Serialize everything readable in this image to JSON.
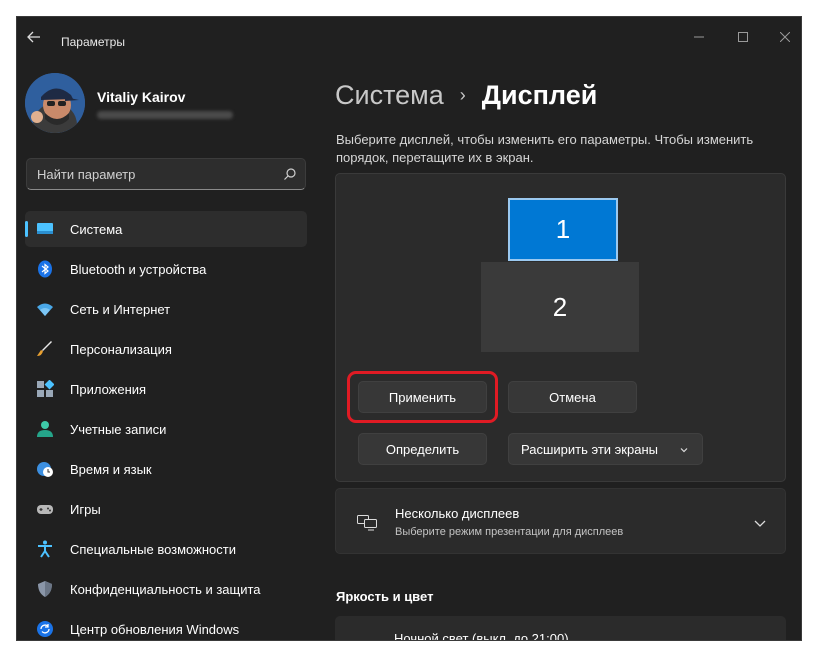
{
  "window": {
    "title": "Параметры"
  },
  "profile": {
    "name": "Vitaliy Kairov"
  },
  "search": {
    "placeholder": "Найти параметр"
  },
  "sidebar": {
    "items": [
      {
        "label": "Система",
        "icon": "display-icon",
        "active": true
      },
      {
        "label": "Bluetooth и устройства",
        "icon": "bluetooth-icon"
      },
      {
        "label": "Сеть и Интернет",
        "icon": "wifi-icon"
      },
      {
        "label": "Персонализация",
        "icon": "brush-icon"
      },
      {
        "label": "Приложения",
        "icon": "apps-icon"
      },
      {
        "label": "Учетные записи",
        "icon": "account-icon"
      },
      {
        "label": "Время и язык",
        "icon": "globe-clock-icon"
      },
      {
        "label": "Игры",
        "icon": "gamepad-icon"
      },
      {
        "label": "Специальные возможности",
        "icon": "accessibility-icon"
      },
      {
        "label": "Конфиденциальность и защита",
        "icon": "shield-icon"
      },
      {
        "label": "Центр обновления Windows",
        "icon": "update-icon"
      }
    ]
  },
  "breadcrumb": {
    "parent": "Система",
    "separator": "›",
    "current": "Дисплей"
  },
  "main": {
    "description": "Выберите дисплей, чтобы изменить его параметры. Чтобы изменить порядок, перетащите их в экран.",
    "monitors": {
      "first": "1",
      "second": "2"
    },
    "buttons": {
      "apply": "Применить",
      "cancel": "Отмена",
      "identify": "Определить",
      "extend": "Расширить эти экраны"
    },
    "multiple_displays": {
      "title": "Несколько дисплеев",
      "subtitle": "Выберите режим презентации для дисплеев"
    },
    "brightness_section": "Яркость и цвет",
    "night_light": "Ночной свет (выкл. до 21:00)"
  },
  "colors": {
    "accent": "#0078d4",
    "highlight": "#e01b24",
    "background": "#202020",
    "card": "#2b2b2b"
  }
}
